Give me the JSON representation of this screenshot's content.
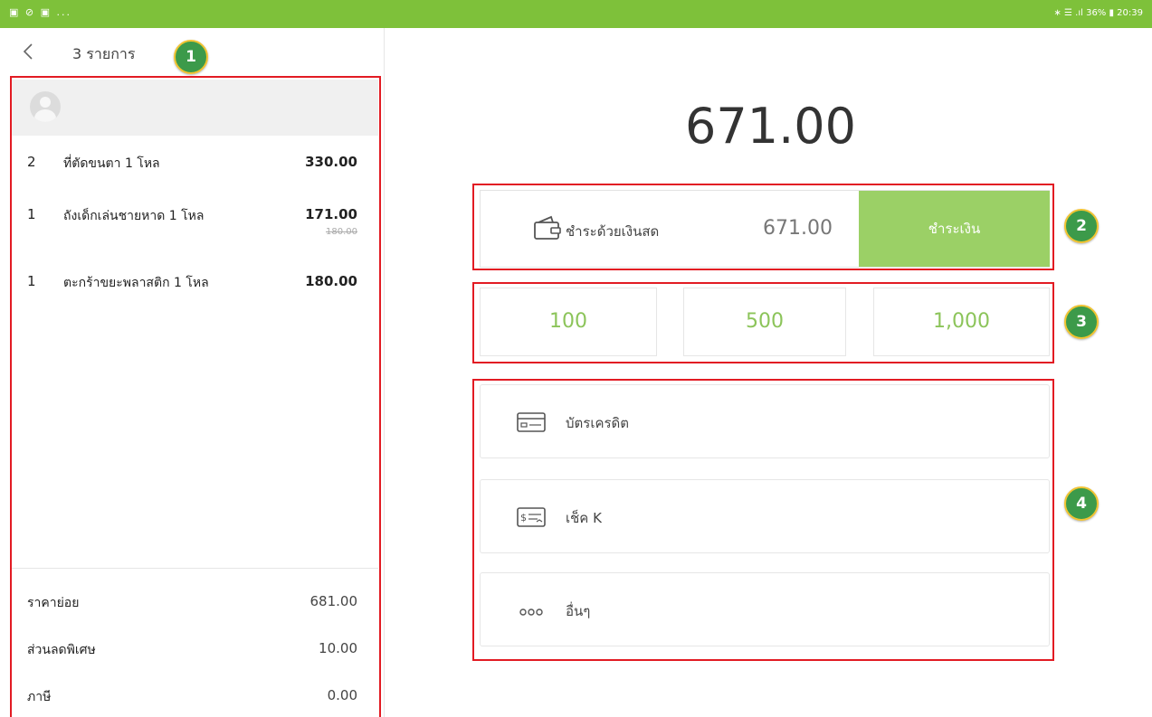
{
  "status_bar": {
    "left": "▣ ⊘ ▣ ...",
    "right": "∗ ☰ .ıl 36% ▮ 20:39"
  },
  "header": {
    "title": "3 รายการ"
  },
  "badges": [
    "1",
    "2",
    "3",
    "4"
  ],
  "items": [
    {
      "qty": "2",
      "name": "ที่ตัดขนตา 1 โหล",
      "price": "330.00",
      "original_price": ""
    },
    {
      "qty": "1",
      "name": "ถังเด็กเล่นชายหาด 1 โหล",
      "price": "171.00",
      "original_price": "180.00"
    },
    {
      "qty": "1",
      "name": "ตะกร้าขยะพลาสติก 1 โหล",
      "price": "180.00",
      "original_price": ""
    }
  ],
  "summary": {
    "subtotal_label": "ราคาย่อย",
    "subtotal": "681.00",
    "discount_label": "ส่วนลดพิเศษ",
    "discount": "10.00",
    "tax_label": "ภาษี",
    "tax": "0.00"
  },
  "payment": {
    "total": "671.00",
    "cash_label": "ชำระด้วยเงินสด",
    "cash_amount": "671.00",
    "pay_button": "ชำระเงิน",
    "quick_amounts": [
      "100",
      "500",
      "1,000"
    ],
    "methods": [
      {
        "label": "บัตรเครดิต",
        "icon": "credit-card-icon"
      },
      {
        "label": "เช็ค K",
        "icon": "check-icon"
      },
      {
        "label": "อื่นๆ",
        "icon": "more-icon"
      }
    ]
  },
  "colors": {
    "status_bar": "#7ec13a",
    "accent": "#9bd066",
    "highlight_box": "#e21b23",
    "badge": "#3c9a4a"
  }
}
